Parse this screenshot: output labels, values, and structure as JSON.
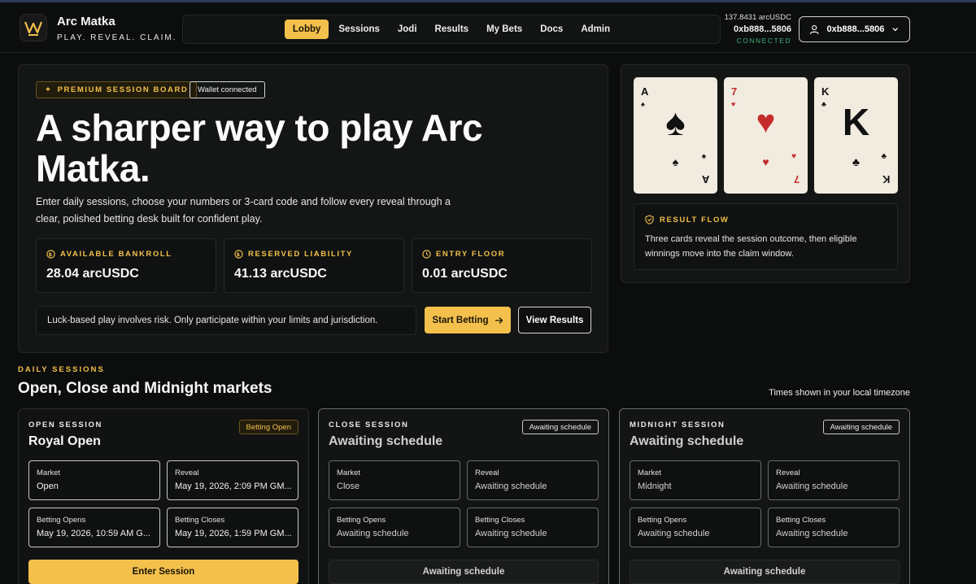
{
  "brand": {
    "name": "Arc Matka",
    "tagline": "PLAY. REVEAL. CLAIM."
  },
  "nav": [
    "Lobby",
    "Sessions",
    "Jodi",
    "Results",
    "My Bets",
    "Docs",
    "Admin"
  ],
  "nav_active": "Lobby",
  "wallet": {
    "balance": "137.8431 arcUSDC",
    "address": "0xb888...5806",
    "status": "CONNECTED",
    "button_label": "0xb888...5806"
  },
  "hero": {
    "badge": "PREMIUM SESSION BOARD",
    "wallet_badge": "Wallet connected",
    "title": "A sharper way to play Arc Matka.",
    "description": "Enter daily sessions, choose your numbers or 3-card code and follow every reveal through a clear, polished betting desk built for confident play.",
    "stats": [
      {
        "label": "AVAILABLE BANKROLL",
        "value": "28.04 arcUSDC"
      },
      {
        "label": "RESERVED LIABILITY",
        "value": "41.13 arcUSDC"
      },
      {
        "label": "ENTRY FLOOR",
        "value": "0.01 arcUSDC"
      }
    ],
    "risk_note": "Luck-based play involves risk. Only participate within your limits and jurisdiction.",
    "start_label": "Start Betting",
    "results_label": "View Results"
  },
  "cards": [
    {
      "rank": "A",
      "suit": "♠",
      "color": "black"
    },
    {
      "rank": "7",
      "suit": "♥",
      "color": "red"
    },
    {
      "rank": "K",
      "suit": "♣",
      "color": "black"
    }
  ],
  "result_flow": {
    "label": "RESULT FLOW",
    "text": "Three cards reveal the session outcome, then eligible winnings move into the claim window."
  },
  "daily": {
    "eyebrow": "DAILY SESSIONS",
    "title": "Open, Close and Midnight markets",
    "timezone_note": "Times shown in your local timezone"
  },
  "sessions": [
    {
      "label": "OPEN SESSION",
      "name": "Royal Open",
      "status": "Betting Open",
      "market_label": "Market",
      "market": "Open",
      "reveal_label": "Reveal",
      "reveal": "May 19, 2026, 2:09 PM GM...",
      "opens_label": "Betting Opens",
      "opens": "May 19, 2026, 10:59 AM G...",
      "closes_label": "Betting Closes",
      "closes": "May 19, 2026, 1:59 PM GM...",
      "button": "Enter Session"
    },
    {
      "label": "CLOSE SESSION",
      "name": "Awaiting schedule",
      "status": "Awaiting schedule",
      "market_label": "Market",
      "market": "Close",
      "reveal_label": "Reveal",
      "reveal": "Awaiting schedule",
      "opens_label": "Betting Opens",
      "opens": "Awaiting schedule",
      "closes_label": "Betting Closes",
      "closes": "Awaiting schedule",
      "button": "Awaiting schedule"
    },
    {
      "label": "MIDNIGHT SESSION",
      "name": "Awaiting schedule",
      "status": "Awaiting schedule",
      "market_label": "Market",
      "market": "Midnight",
      "reveal_label": "Reveal",
      "reveal": "Awaiting schedule",
      "opens_label": "Betting Opens",
      "opens": "Awaiting schedule",
      "closes_label": "Betting Closes",
      "closes": "Awaiting schedule",
      "button": "Awaiting schedule"
    }
  ],
  "colors": {
    "accent": "#f3c04b",
    "connected": "#3db37a",
    "background": "#0c0d0d",
    "panel": "#131614"
  }
}
